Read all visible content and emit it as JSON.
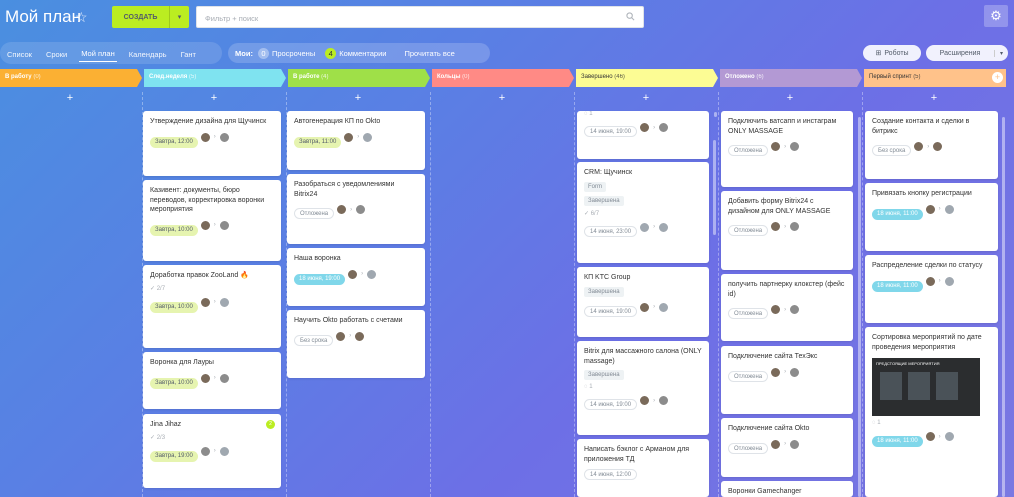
{
  "header": {
    "title": "Мой план",
    "create_label": "СОЗДАТЬ",
    "search_placeholder": "Фильтр + поиск"
  },
  "nav": {
    "tabs": [
      "Список",
      "Сроки",
      "Мой план",
      "Календарь",
      "Гант"
    ],
    "mine_label": "Мои:",
    "overdue": {
      "count": "0",
      "label": "Просрочены"
    },
    "comments": {
      "count": "4",
      "label": "Комментарии"
    },
    "read_all": "Прочитать все",
    "robots": "Роботы",
    "extensions": "Расширения"
  },
  "columns": [
    {
      "name": "В работу",
      "count": "(0)",
      "color": "#fbb033"
    },
    {
      "name": "След.неделя",
      "count": "(5)",
      "color": "#7fe3f0"
    },
    {
      "name": "В работе",
      "count": "(4)",
      "color": "#9fe048"
    },
    {
      "name": "Кольцы",
      "count": "(0)",
      "color": "#ff8a85"
    },
    {
      "name": "Завершено",
      "count": "(46)",
      "color": "#fcfc94"
    },
    {
      "name": "Отложено",
      "count": "(6)",
      "color": "#b399d4"
    },
    {
      "name": "Первый спринт",
      "count": "(5)",
      "color": "#ffc28a"
    }
  ],
  "cards": {
    "c1": [
      {
        "title": "Утверждение дизайна для Щучинск",
        "badge": "Завтра, 12:00"
      },
      {
        "title": "Казивент: документы, бюро переводов, корректировка воронки мероприятия",
        "badge": "Завтра, 10:00"
      },
      {
        "title": "Доработка правок ZooLand",
        "check": "2/7",
        "badge": "Завтра, 10:00"
      },
      {
        "title": "Воронка для Лауры",
        "badge": "Завтра, 10:00"
      },
      {
        "title": "Jina Jihaz",
        "check": "2/3",
        "badge": "Завтра, 19:00",
        "dot": "2"
      }
    ],
    "c2": [
      {
        "title": "Автогенерация КП по Okto",
        "badge": "Завтра, 11:00"
      },
      {
        "title": "Разобраться с уведомлениями Bitrix24",
        "badge": "Отложена"
      },
      {
        "title": "Наша воронка",
        "badge": "18 июня, 19:00"
      },
      {
        "title": "Научить Okto работать с счетами",
        "badge": "Без срока"
      }
    ],
    "c4": [
      {
        "check": "1",
        "badge": "14 июня, 19:00"
      },
      {
        "title": "CRM: Щучинск",
        "tag1": "Form",
        "tag2": "Завершена",
        "check": "6/7",
        "badge": "14 июня, 23:00"
      },
      {
        "title": "КП KTC Group",
        "tag2": "Завершена",
        "badge": "14 июня, 19:00"
      },
      {
        "title": "Bitrix для массажного салона (ONLY massage)",
        "tag2": "Завершена",
        "check": "1",
        "badge": "14 июня, 19:00"
      },
      {
        "title": "Написать бэклог с Арманом для приложения ТД",
        "badge": "14 июня, 12:00"
      }
    ],
    "c5": [
      {
        "title": "Подключить ватсапп и инстаграм ONLY MASSAGE",
        "badge": "Отложена"
      },
      {
        "title": "Добавить форму Bitrix24 с дизайном для ONLY MASSAGE",
        "badge": "Отложена"
      },
      {
        "title": "получить партнерку клокстер (фейс id)",
        "badge": "Отложена"
      },
      {
        "title": "Подключение сайта ТехЭкс",
        "badge": "Отложена"
      },
      {
        "title": "Подключение сайта Okto",
        "badge": "Отложена"
      },
      {
        "title": "Воронки Gamechanger"
      }
    ],
    "c6": [
      {
        "title": "Создание контакта и сделки в битрикс",
        "badge": "Без срока"
      },
      {
        "title": "Привязать кнопку регистрации",
        "badge": "18 июня, 11:00"
      },
      {
        "title": "Распределение сделки по статусу",
        "badge": "18 июня, 11:00"
      },
      {
        "title": "Сортировка мероприятий по дате проведения мероприятия",
        "image_caption": "ПРЕДСТОЯЩИЕ МЕРОПРИЯТИЯ",
        "check": "1",
        "badge": "18 июня, 11:00"
      }
    ]
  }
}
